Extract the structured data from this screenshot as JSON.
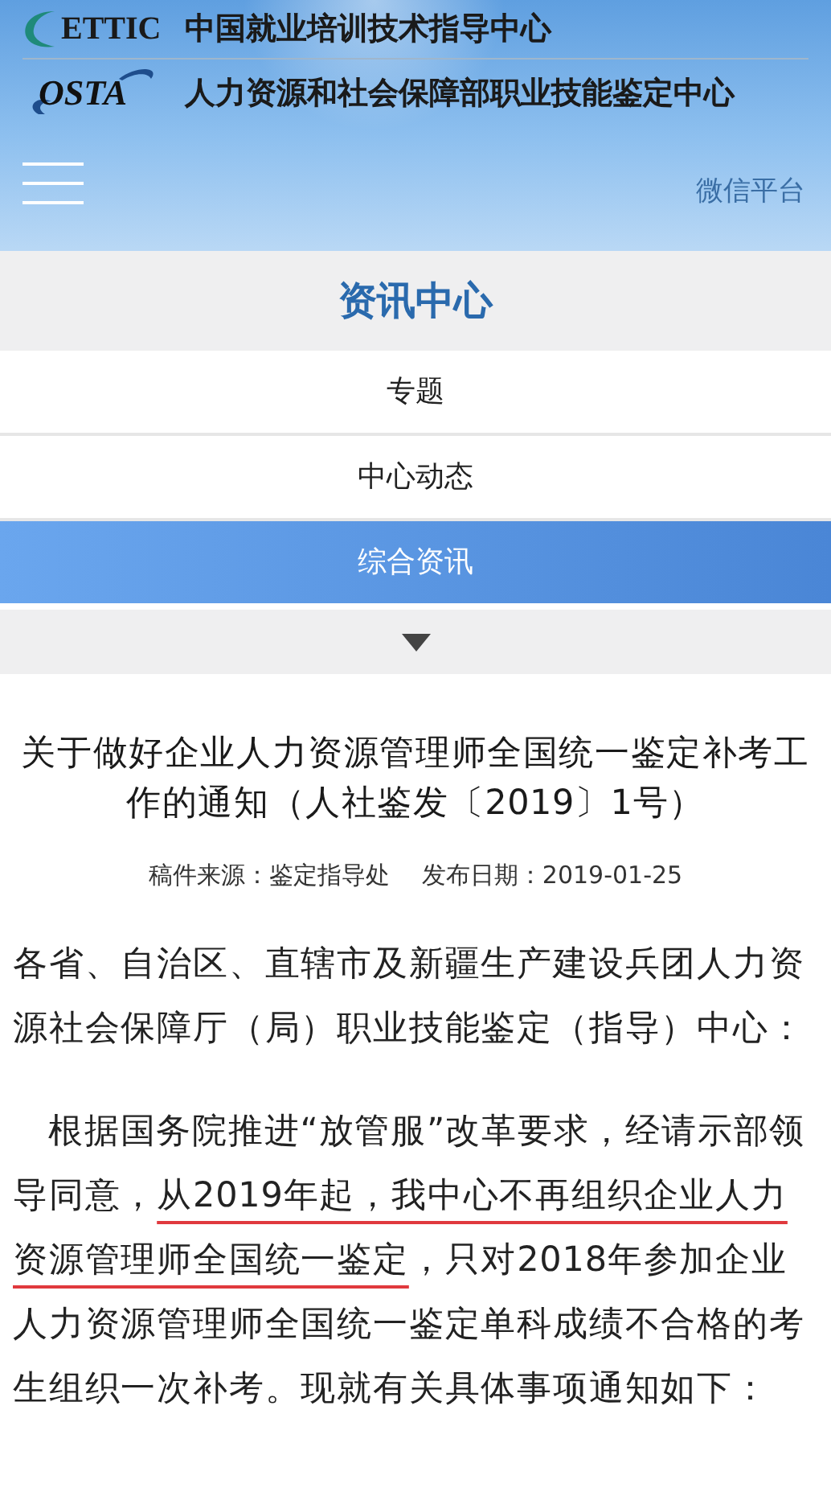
{
  "header": {
    "logos": [
      {
        "kind": "ettic",
        "mark": "ETTIC",
        "name": "中国就业培训技术指导中心"
      },
      {
        "kind": "osta",
        "mark": "OSTA",
        "name": "人力资源和社会保障部职业技能鉴定中心"
      }
    ],
    "wechat_link": "微信平台"
  },
  "section": {
    "title": "资讯中心",
    "items": [
      {
        "label": "专题",
        "selected": false
      },
      {
        "label": "中心动态",
        "selected": false
      },
      {
        "label": "综合资讯",
        "selected": true
      }
    ]
  },
  "article": {
    "title_lines": [
      "关于做好企业人力资源管理师全国统一鉴定补考工",
      "作的通知（人社鉴发〔2019〕1号）"
    ],
    "source": "稿件来源：鉴定指导处",
    "date": "发布日期：2019-01-25",
    "paragraphs": [
      {
        "indent": false,
        "segments": [
          {
            "text": "各省、自治区、直辖市及新疆生产建设兵团人力资源社会保障厅（局）职业技能鉴定（指导）中心：",
            "underlined": false
          }
        ]
      },
      {
        "indent": true,
        "segments": [
          {
            "text": "根据国务院推进“放管服”改革要求，经请示部领导同意，",
            "underlined": false
          },
          {
            "text": "从2019年起，我中心不再组织企业人力资源管理师全国统一鉴定",
            "underlined": true
          },
          {
            "text": "，只对2018年参加企业人力资源管理师全国统一鉴定单科成绩不合格的考生组织一次补考。现就有关具体事项通知如下：",
            "underlined": false
          }
        ]
      }
    ]
  }
}
